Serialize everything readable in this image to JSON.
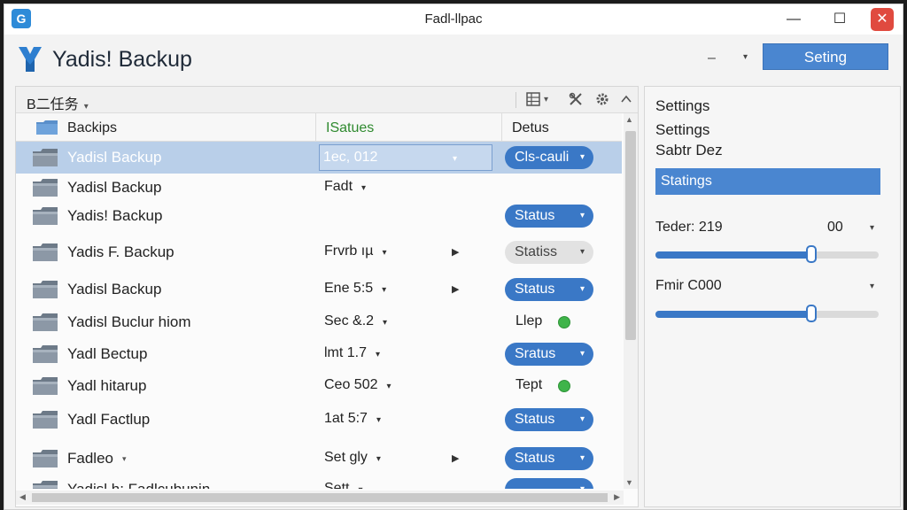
{
  "window": {
    "title": "Fadl-llpac",
    "app_icon_glyph": "G",
    "minimize_glyph": "—",
    "maximize_glyph": "☐",
    "close_glyph": "✕"
  },
  "header": {
    "app_name": "Yadis! Backup",
    "logo_icon": "blue-y-logo-icon",
    "minimize_glyph": "–",
    "dropdown_glyph": "▾",
    "setting_button": "Seting"
  },
  "toolbar": {
    "task_label": "B二任务",
    "caret": "▾",
    "icons": [
      "grid-icon",
      "tools-icon",
      "gear-icon",
      "chevron-up-icon"
    ]
  },
  "columns": {
    "backups": "Backips",
    "status": "ISatues",
    "details": "Detus"
  },
  "rows": [
    {
      "name": "Yadisl Backup",
      "value": "1ec, 012",
      "selected": true,
      "status": "Cls-cauli",
      "status_type": "pill"
    },
    {
      "name": "Yadisl Backup",
      "value": "Fadt",
      "status": "",
      "status_type": "none"
    },
    {
      "name": "Yadis! Backup",
      "value": "",
      "status": "Status",
      "status_type": "pill"
    },
    {
      "name": "Yadis F. Backup",
      "value": "Frvrb ıµ",
      "arrow": true,
      "status": "Statiss",
      "status_type": "grey"
    },
    {
      "name": "Yadisl Backup",
      "value": "Ene 5:5",
      "arrow": true,
      "status": "Status",
      "status_type": "pill"
    },
    {
      "name": "Yadisl Buclur hiom",
      "value": "Sec &.2",
      "status": "Llep",
      "status_type": "dot"
    },
    {
      "name": "Yadl Bectup",
      "value": "lmt 1.7",
      "status": "Sratus",
      "status_type": "pill"
    },
    {
      "name": "Yadl hitarup",
      "value": "Ceo 502",
      "status": "Tept",
      "status_type": "dot"
    },
    {
      "name": "Yadl Factlup",
      "value": "1at 5:7",
      "status": "Status",
      "status_type": "pill"
    },
    {
      "name": "Fadleo",
      "name_caret": true,
      "value": "Set gly",
      "arrow": true,
      "status": "Status",
      "status_type": "pill"
    },
    {
      "name": "Yadisl h: Fadlcubunin",
      "value": "Sett",
      "status": "",
      "status_type": "pill"
    }
  ],
  "right_panel": {
    "line1": "Settings",
    "line2": "Settings",
    "line3": "Sabtr Dez",
    "active_item": "Statings",
    "slider1": {
      "label": "Teder: 219",
      "value_text": "00",
      "level": 0.7
    },
    "slider2": {
      "label": "Fmir C000",
      "level": 0.7
    }
  },
  "colors": {
    "accent": "#4a86d0",
    "pill": "#3a78c6",
    "selected_row": "#b9cfe9",
    "status_green": "#3fb44a",
    "close_red": "#e04a3f",
    "status_column_header": "#2f8a2f"
  }
}
